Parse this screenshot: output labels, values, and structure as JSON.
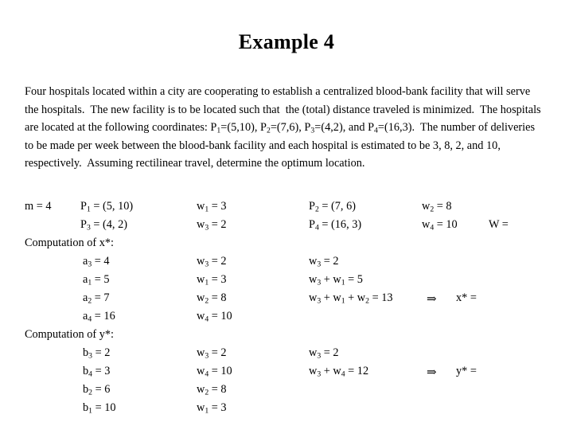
{
  "slide": {
    "title": "Example 4",
    "problem_paragraph": "Four hospitals located within a city are cooperating to establish a centralized blood-bank facility that will serve the hospitals.  The new facility is to be located such that  the (total) distance traveled is minimized.  The hospitals are located at the following coordinates: P1=(5,10), P2=(7,6), P3=(4,2), and P4=(16,3).  The number of deliveries to be made per week between the blood-bank facility and each hospital is estimated to be 3, 8, 2, and 10, respectively.  Assuming rectilinear travel, determine the optimum location.",
    "paragraph_segments": [
      {
        "text": "Four hospitals located within a city are cooperating to establish a centralized blood-bank facility that will serve the hospitals.  The new facility is to be located such that  the (total) distance traveled is minimized.  The hospitals are located at the following coordinates: P"
      },
      {
        "sub": "1"
      },
      {
        "text": "=(5,10), P"
      },
      {
        "sub": "2"
      },
      {
        "text": "=(7,6), P"
      },
      {
        "sub": "3"
      },
      {
        "text": "=(4,2), and P"
      },
      {
        "sub": "4"
      },
      {
        "text": "=(16,3).  The number of deliveries to be made per week between the blood-bank facility and each hospital is estimated to be 3, 8, 2, and 10, respectively.  Assuming rectilinear travel, determine the optimum location."
      }
    ],
    "labels": {
      "computation_x": "Computation of x*:",
      "computation_y": "Computation of y*:",
      "m_value": "m = 4",
      "W_value": "W =",
      "x_result": "x* =",
      "y_result": "y* =",
      "arrow": "⇒"
    },
    "given": {
      "points": [
        {
          "point": "P1 = (5, 10)",
          "weight": "w1 = 3"
        },
        {
          "point": "P3 = (4, 2)",
          "weight": "w3 = 2"
        },
        {
          "point": "P2 = (7, 6)",
          "weight": "w2 = 8"
        },
        {
          "point": "P4 = (16, 3)",
          "weight": "w4 = 10"
        }
      ]
    },
    "x_rows": [
      {
        "coord": "a3 = 4",
        "weight": "w3 = 2",
        "cumulative": "w3 = 2",
        "arrow": "",
        "result": ""
      },
      {
        "coord": "a1 = 5",
        "weight": "w1 = 3",
        "cumulative": "w3 + w1 = 5",
        "arrow": "",
        "result": ""
      },
      {
        "coord": "a2 = 7",
        "weight": "w2 = 8",
        "cumulative": "w3 + w1 + w2 = 13",
        "arrow": "⇒",
        "result": "x* ="
      },
      {
        "coord": "a4 = 16",
        "weight": "w4 = 10",
        "cumulative": "",
        "arrow": "",
        "result": ""
      }
    ],
    "y_rows": [
      {
        "coord": "b3 = 2",
        "weight": "w3 = 2",
        "cumulative": "w3 = 2",
        "arrow": "",
        "result": ""
      },
      {
        "coord": "b4 = 3",
        "weight": "w4 = 10",
        "cumulative": "w3 + w4 = 12",
        "arrow": "⇒",
        "result": "y* ="
      },
      {
        "coord": "b2 = 6",
        "weight": "w2 = 8",
        "cumulative": "",
        "arrow": "",
        "result": ""
      },
      {
        "coord": "b1 = 10",
        "weight": "w1 = 3",
        "cumulative": "",
        "arrow": "",
        "result": ""
      }
    ],
    "colors": {
      "background": "#ffffff",
      "text": "#000000"
    }
  }
}
